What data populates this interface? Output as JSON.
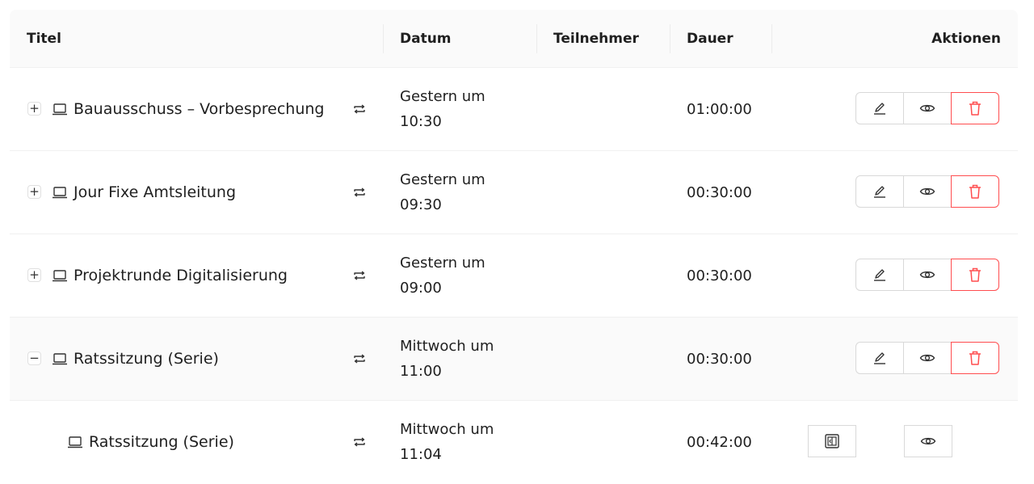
{
  "table": {
    "headers": {
      "title": "Titel",
      "date": "Datum",
      "participants": "Teilnehmer",
      "duration": "Dauer",
      "actions": "Aktionen"
    },
    "rows": [
      {
        "expander": "+",
        "title": "Bauausschuss – Vorbesprechung",
        "date_line1": "Gestern um",
        "date_line2": "10:30",
        "participants": "",
        "duration": "01:00:00"
      },
      {
        "expander": "+",
        "title": "Jour Fixe Amtsleitung",
        "date_line1": "Gestern um",
        "date_line2": "09:30",
        "participants": "",
        "duration": "00:30:00"
      },
      {
        "expander": "+",
        "title": "Projektrunde Digitalisierung",
        "date_line1": "Gestern um",
        "date_line2": "09:00",
        "participants": "",
        "duration": "00:30:00"
      },
      {
        "expander": "−",
        "title": "Ratssitzung (Serie)",
        "date_line1": "Mittwoch um",
        "date_line2": "11:00",
        "participants": "",
        "duration": "00:30:00",
        "expanded": true
      },
      {
        "child": true,
        "title": "Ratssitzung (Serie)",
        "date_line1": "Mittwoch um",
        "date_line2": "11:04",
        "participants": "",
        "duration": "00:42:00"
      }
    ]
  },
  "colors": {
    "header_bg": "#fafafa",
    "danger": "#ff4d4f",
    "border": "#d9d9d9"
  },
  "icons": {
    "row": "laptop-icon",
    "recurring": "repeat-icon",
    "edit": "pencil-icon",
    "view": "eye-icon",
    "delete": "trash-icon",
    "child_action": "panel-icon"
  }
}
